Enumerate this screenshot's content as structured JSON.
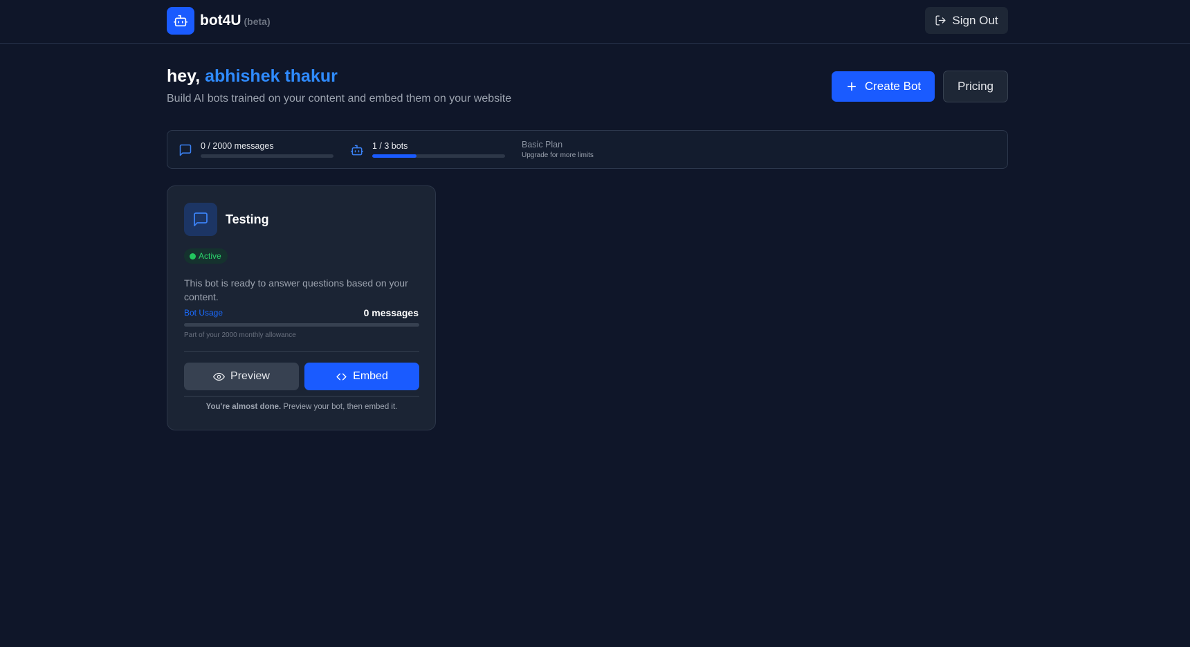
{
  "header": {
    "brand": "bot4U",
    "beta": "(beta)",
    "sign_out_label": "Sign Out"
  },
  "greeting": {
    "prefix": "hey,",
    "name": "abhishek thakur",
    "subtitle": "Build AI bots trained on your content and embed them on your website"
  },
  "actions": {
    "create_label": "Create Bot",
    "pricing_label": "Pricing"
  },
  "usage": {
    "messages_label": "0 / 2000 messages",
    "messages_fraction": 0,
    "bots_label": "1 / 3 bots",
    "bots_fraction": 0.3333,
    "plan_name": "Basic Plan",
    "plan_hint": "Upgrade for more limits"
  },
  "bots": [
    {
      "name": "Testing",
      "status": "Active",
      "description": "This bot is ready to answer questions based on your content.",
      "usage_label": "Bot Usage",
      "usage_count": "0 messages",
      "usage_fraction": 0,
      "usage_note": "Part of your 2000 monthly allowance",
      "preview_label": "Preview",
      "embed_label": "Embed",
      "footnote_bold": "You're almost done.",
      "footnote_rest": " Preview your bot, then embed it."
    }
  ],
  "colors": {
    "background": "#0f1629",
    "accent": "#1a5bff",
    "name_highlight": "#2f8bff",
    "active_green": "#22c55e"
  },
  "icons": {
    "logo": "robot-icon",
    "sign_out": "sign-out-icon",
    "create": "plus-icon",
    "messages": "chat-bubble-icon",
    "bots": "robot-icon",
    "bot_card": "chat-bubble-icon",
    "preview": "eye-icon",
    "embed": "code-icon"
  }
}
